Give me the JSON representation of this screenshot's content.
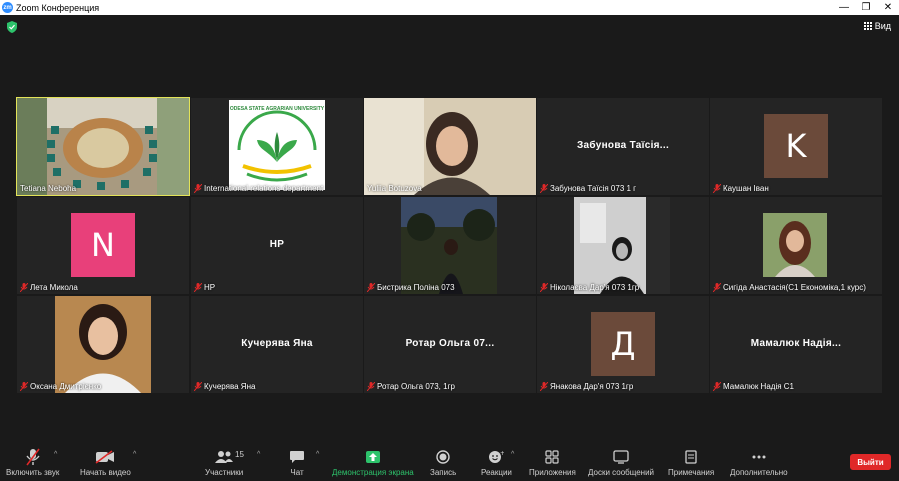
{
  "window": {
    "title": "Zoom Конференция",
    "controls": [
      "—",
      "❐",
      "✕"
    ]
  },
  "topbar": {
    "view_label": "Вид"
  },
  "tiles": [
    {
      "name": "Tetiana Neboha",
      "muted": false,
      "kind": "video"
    },
    {
      "name": "International relations department",
      "muted": true,
      "kind": "logo",
      "logo_text": "ODESA STATE AGRARIAN UNIVERSITY"
    },
    {
      "name": "Yuliia Botuzova",
      "muted": false,
      "kind": "video"
    },
    {
      "name": "Забунова Таїсія 073 1 г",
      "muted": true,
      "kind": "text",
      "display": "Забунова  Таїсія..."
    },
    {
      "name": "Каушан Іван",
      "muted": true,
      "kind": "avatar",
      "letter": "K",
      "color": "#6b4a3a"
    },
    {
      "name": "Лета Микола",
      "muted": true,
      "kind": "avatar",
      "letter": "N",
      "color": "#e8407a"
    },
    {
      "name": "НР",
      "muted": true,
      "kind": "text",
      "display": "НР"
    },
    {
      "name": "Бистрика Поліна 073",
      "muted": true,
      "kind": "video"
    },
    {
      "name": "Ніколаєва Дар'я 073 1гр",
      "muted": true,
      "kind": "video"
    },
    {
      "name": "Сигіда Анастасія(С1 Економіка,1 курс)",
      "muted": true,
      "kind": "video"
    },
    {
      "name": "Оксана Дмитрієнко",
      "muted": true,
      "kind": "video"
    },
    {
      "name": "Кучерява Яна",
      "muted": true,
      "kind": "text",
      "display": "Кучерява Яна"
    },
    {
      "name": "Ротар Ольга 073, 1гр",
      "muted": true,
      "kind": "text",
      "display": "Ротар  Ольга 07..."
    },
    {
      "name": "Янакова Дар'я 073 1гр",
      "muted": true,
      "kind": "avatar",
      "letter": "Д",
      "color": "#6b4a3a"
    },
    {
      "name": "Мамалюк Надія С1",
      "muted": true,
      "kind": "text",
      "display": "Мамалюк  Надія..."
    }
  ],
  "toolbar": {
    "unmute": "Включить звук",
    "start_video": "Начать видео",
    "participants": "Участники",
    "participants_count": "15",
    "chat": "Чат",
    "share": "Демонстрация экрана",
    "record": "Запись",
    "reactions": "Реакции",
    "apps": "Приложения",
    "whiteboards": "Доски сообщений",
    "notes": "Примечания",
    "more": "Дополнительно",
    "leave": "Выйти"
  },
  "colors": {
    "accent_green": "#2dc26b",
    "leave_red": "#e02828",
    "active_speaker": "#e3e358"
  }
}
